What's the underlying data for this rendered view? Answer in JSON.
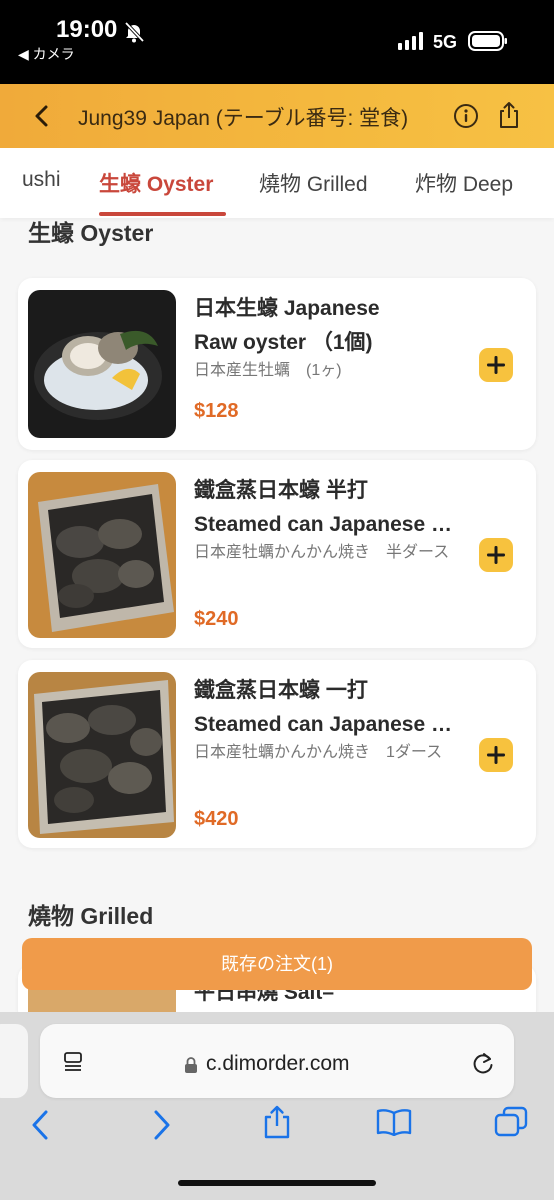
{
  "status": {
    "time": "19:00",
    "back_app": "◀ カメラ",
    "network": "5G"
  },
  "header": {
    "title": "Jung39 Japan (テーブル番号: 堂食)"
  },
  "tabs": [
    {
      "label": "Sushi",
      "visible": "ushi"
    },
    {
      "label": "生蠔 Oyster",
      "active": true
    },
    {
      "label": "燒物 Grilled"
    },
    {
      "label": "炸物 Deep"
    }
  ],
  "sections": {
    "oyster": "生蠔 Oyster",
    "grilled": "燒物 Grilled"
  },
  "items": [
    {
      "name_l1": "日本生蠔 Japanese",
      "name_l2": "Raw oyster （1個)",
      "desc": "日本産生牡蠣　(1ヶ)",
      "price": "$128"
    },
    {
      "name_l1": "鐵盒蒸日本蠔 半打",
      "name_l2": "Steamed can Japanese oyster",
      "desc": "日本産牡蠣かんかん焼き　半ダース",
      "price": "$240"
    },
    {
      "name_l1": "鐵盒蒸日本蠔 一打",
      "name_l2": "Steamed can Japanese oyster",
      "desc": "日本産牡蠣かんかん焼き　1ダース",
      "price": "$420"
    }
  ],
  "partial_item": {
    "name_l1": "平日串燒 Salt–"
  },
  "order_bar": {
    "label": "既存の注文(1)"
  },
  "safari": {
    "url": "c.dimorder.com"
  },
  "colors": {
    "accent": "#c9473b",
    "price": "#e06a26",
    "header": "#f4b93e",
    "add_button": "#f7c23e",
    "order_bar": "#f09b4a"
  }
}
